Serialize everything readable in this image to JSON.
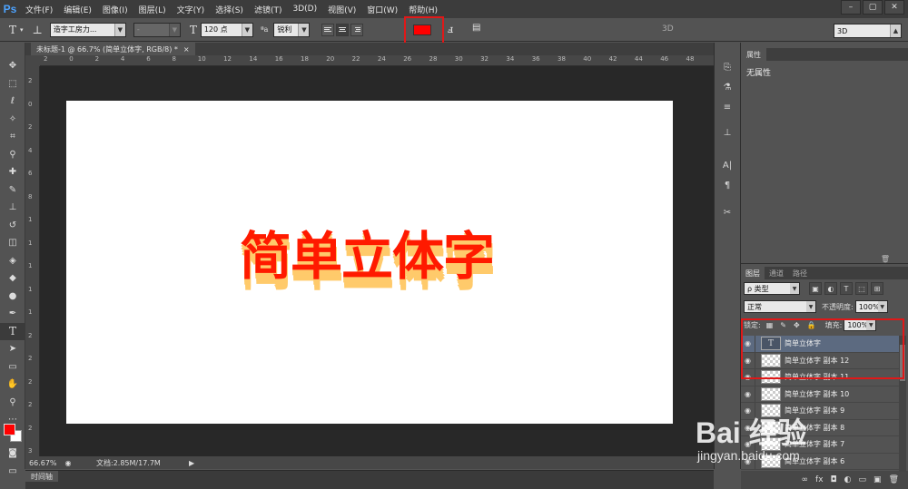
{
  "app": {
    "logo": "Ps"
  },
  "menu": [
    "文件(F)",
    "编辑(E)",
    "图像(I)",
    "图层(L)",
    "文字(Y)",
    "选择(S)",
    "滤镜(T)",
    "3D(D)",
    "视图(V)",
    "窗口(W)",
    "帮助(H)"
  ],
  "window_controls": [
    "–",
    "▢",
    "✕"
  ],
  "options": {
    "font_family": "造字工房力...",
    "font_style": "-",
    "font_size": "120 点",
    "antialias_icon": "ªa",
    "antialias": "锐利",
    "label_3d": "3D",
    "workspace": "3D",
    "text_color": "#ff0000"
  },
  "document": {
    "tab_title": "未标题-1 @ 66.7% (简单立体字, RGB/8) *",
    "close": "×",
    "artwork_text": "简单立体字",
    "text_color": "#ff1a00",
    "shadow_color": "#ffca6b"
  },
  "ruler": {
    "top": [
      "2",
      "0",
      "2",
      "4",
      "6",
      "8",
      "10",
      "12",
      "14",
      "16",
      "18",
      "20",
      "22",
      "24",
      "26",
      "28",
      "30",
      "32",
      "34",
      "36",
      "38",
      "40",
      "42",
      "44",
      "46",
      "48"
    ],
    "left": [
      "2",
      "0",
      "2",
      "4",
      "6",
      "8",
      "1",
      "1",
      "1",
      "1",
      "1",
      "2",
      "2",
      "2",
      "2",
      "2",
      "3"
    ]
  },
  "status": {
    "zoom": "66.67%",
    "doc_info": "文档:2.85M/17.7M"
  },
  "timeline": {
    "tab": "时间轴"
  },
  "properties": {
    "tab": "属性",
    "content": "无属性"
  },
  "layers_panel": {
    "tabs": [
      "图层",
      "通道",
      "路径"
    ],
    "filter_label": "ρ 类型",
    "blend_mode": "正常",
    "opacity_label": "不透明度:",
    "opacity": "100%",
    "lock_label": "锁定:",
    "fill_label": "填充:",
    "fill": "100%",
    "layers": [
      {
        "name": "简单立体字",
        "type": "text",
        "selected": true
      },
      {
        "name": "简单立体字 副本 12",
        "type": "raster",
        "selected": false
      },
      {
        "name": "简单立体字 副本 11",
        "type": "raster",
        "selected": false
      },
      {
        "name": "简单立体字 副本 10",
        "type": "raster",
        "selected": false
      },
      {
        "name": "简单立体字 副本 9",
        "type": "raster",
        "selected": false
      },
      {
        "name": "简单立体字 副本 8",
        "type": "raster",
        "selected": false
      },
      {
        "name": "简单立体字 副本 7",
        "type": "raster",
        "selected": false
      },
      {
        "name": "简单立体字 副本 6",
        "type": "raster",
        "selected": false
      }
    ],
    "footer_icons": [
      "∞",
      "fx",
      "◘",
      "◐",
      "▭",
      "▣",
      "🗑"
    ]
  },
  "watermark": {
    "main": "Bai 经验",
    "sub": "jingyan.baidu.com"
  }
}
